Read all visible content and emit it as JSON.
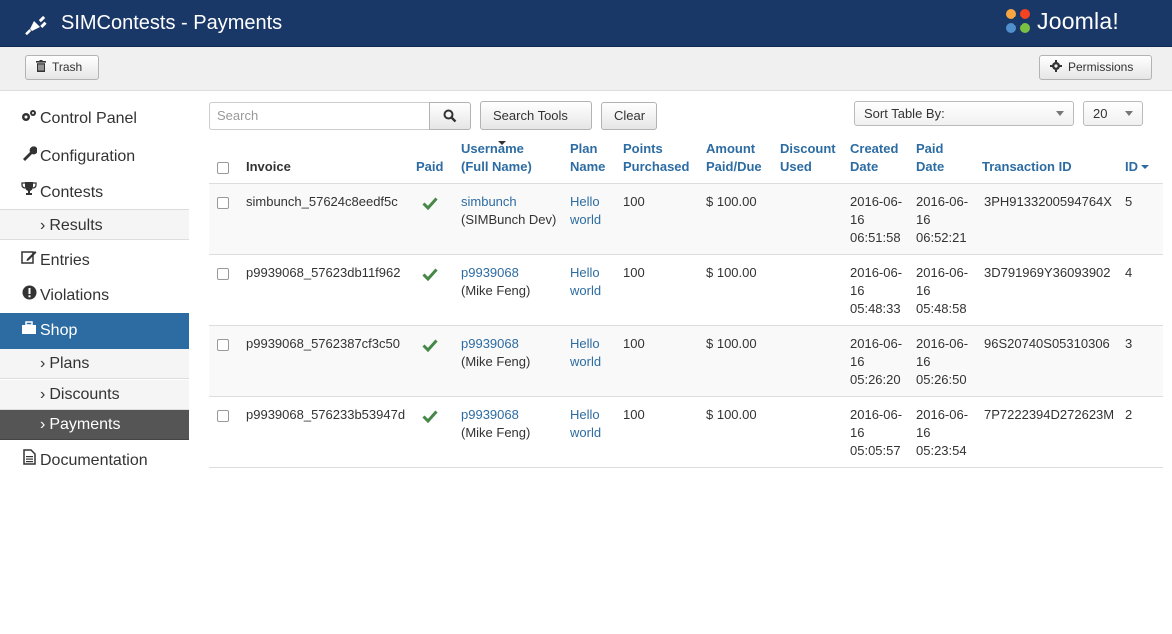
{
  "header": {
    "title": "SIMContests - Payments",
    "logo_text": "Joomla!",
    "logo_reg": "®"
  },
  "toolbar": {
    "trash_label": "Trash",
    "permissions_label": "Permissions"
  },
  "sidebar": {
    "items": [
      {
        "label": "Control Panel",
        "icon": "cogs-icon"
      },
      {
        "label": "Configuration",
        "icon": "wrench-icon"
      },
      {
        "label": "Contests",
        "icon": "trophy-icon"
      },
      {
        "label": "Results",
        "sub": true
      },
      {
        "label": "Entries",
        "icon": "edit-icon"
      },
      {
        "label": "Violations",
        "icon": "exclamation-icon"
      },
      {
        "label": "Shop",
        "icon": "briefcase-icon",
        "active": true
      },
      {
        "label": "Plans",
        "sub": true
      },
      {
        "label": "Discounts",
        "sub": true
      },
      {
        "label": "Payments",
        "sub": true,
        "active": true
      },
      {
        "label": "Documentation",
        "icon": "document-icon"
      }
    ],
    "chevron": "›"
  },
  "filters": {
    "search_placeholder": "Search",
    "search_tools_label": "Search Tools",
    "clear_label": "Clear",
    "sort_label": "Sort Table By:",
    "limit_value": "20"
  },
  "table": {
    "headers": {
      "invoice": "Invoice",
      "paid": "Paid",
      "username_1": "Username",
      "username_2": "(Full Name)",
      "plan_1": "Plan",
      "plan_2": "Name",
      "points_1": "Points",
      "points_2": "Purchased",
      "amount_1": "Amount",
      "amount_2": "Paid/Due",
      "discount_1": "Discount",
      "discount_2": "Used",
      "created_1": "Created",
      "created_2": "Date",
      "paiddate_1": "Paid",
      "paiddate_2": "Date",
      "transaction": "Transaction ID",
      "id": "ID"
    },
    "rows": [
      {
        "invoice": "simbunch_57624c8eedf5c",
        "username": "simbunch",
        "fullname": "(SIMBunch Dev)",
        "plan_1": "Hello",
        "plan_2": "world",
        "points": "100",
        "amount": "$ 100.00",
        "created_1": "2016-06-",
        "created_2": "16",
        "created_3": "06:51:58",
        "paid_1": "2016-06-",
        "paid_2": "16",
        "paid_3": "06:52:21",
        "transaction": "3PH9133200594764X",
        "id": "5"
      },
      {
        "invoice": "p9939068_57623db11f962",
        "username": "p9939068",
        "fullname": "(Mike Feng)",
        "plan_1": "Hello",
        "plan_2": "world",
        "points": "100",
        "amount": "$ 100.00",
        "created_1": "2016-06-",
        "created_2": "16",
        "created_3": "05:48:33",
        "paid_1": "2016-06-",
        "paid_2": "16",
        "paid_3": "05:48:58",
        "transaction": "3D791969Y36093902",
        "id": "4"
      },
      {
        "invoice": "p9939068_5762387cf3c50",
        "username": "p9939068",
        "fullname": "(Mike Feng)",
        "plan_1": "Hello",
        "plan_2": "world",
        "points": "100",
        "amount": "$ 100.00",
        "created_1": "2016-06-",
        "created_2": "16",
        "created_3": "05:26:20",
        "paid_1": "2016-06-",
        "paid_2": "16",
        "paid_3": "05:26:50",
        "transaction": "96S20740S05310306",
        "id": "3"
      },
      {
        "invoice": "p9939068_576233b53947d",
        "username": "p9939068",
        "fullname": "(Mike Feng)",
        "plan_1": "Hello",
        "plan_2": "world",
        "points": "100",
        "amount": "$ 100.00",
        "created_1": "2016-06-",
        "created_2": "16",
        "created_3": "05:05:57",
        "paid_1": "2016-06-",
        "paid_2": "16",
        "paid_3": "05:23:54",
        "transaction": "7P7222394D272623M",
        "id": "2"
      }
    ]
  },
  "colors": {
    "header_bg": "#1a3867",
    "link": "#2d6ca2",
    "active_bg": "#2d6ca2",
    "sub_active_bg": "#555555",
    "check_green": "#468847"
  }
}
